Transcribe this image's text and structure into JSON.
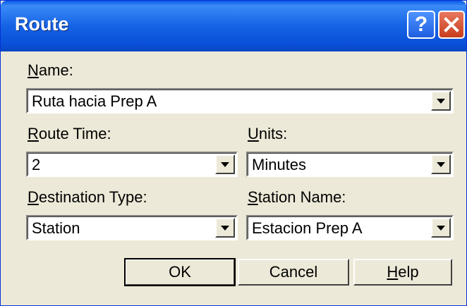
{
  "window": {
    "title": "Route"
  },
  "titlebar": {
    "help_glyph": "?",
    "help_icon": "question-icon",
    "close_icon": "close-icon"
  },
  "fields": {
    "name": {
      "label_mnemonic": "N",
      "label_rest": "ame:",
      "value": "Ruta hacia Prep A"
    },
    "route_time": {
      "label_mnemonic": "R",
      "label_rest": "oute Time:",
      "value": "2"
    },
    "units": {
      "label_mnemonic": "U",
      "label_rest": "nits:",
      "value": "Minutes"
    },
    "destination_type": {
      "label_mnemonic": "D",
      "label_rest": "estination Type:",
      "value": "Station"
    },
    "station_name": {
      "label_mnemonic": "S",
      "label_rest": "tation Name:",
      "value": "Estacion Prep A"
    }
  },
  "buttons": {
    "ok": "OK",
    "cancel": "Cancel",
    "help_mnemonic": "H",
    "help_rest": "elp"
  },
  "colors": {
    "titlebar": "#0a50d8",
    "close_button": "#c83d1d",
    "dialog_bg": "#ece9d8"
  }
}
